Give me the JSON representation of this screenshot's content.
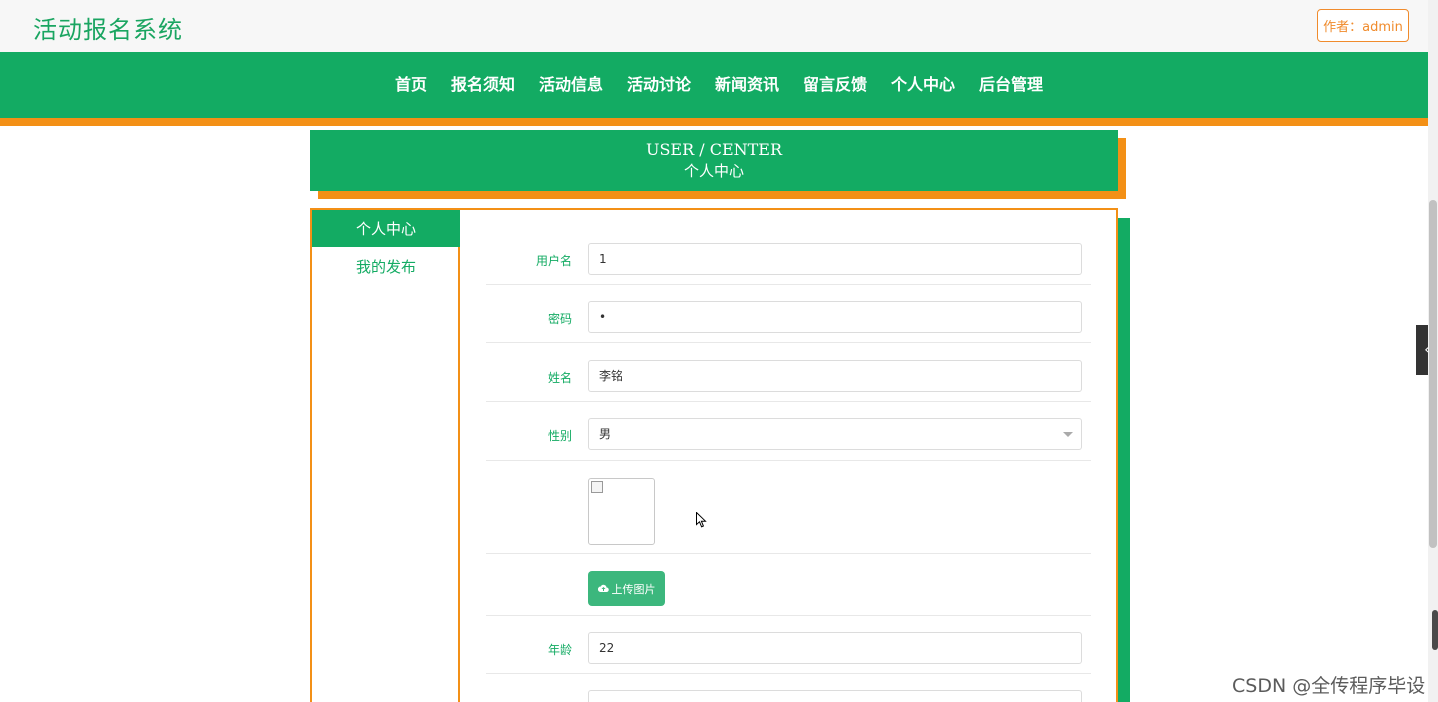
{
  "header": {
    "brand": "活动报名系统",
    "author_button": "作者：admin"
  },
  "nav": {
    "items": [
      "首页",
      "报名须知",
      "活动信息",
      "活动讨论",
      "新闻资讯",
      "留言反馈",
      "个人中心",
      "后台管理"
    ]
  },
  "banner": {
    "title_en": "USER / CENTER",
    "title_cn": "个人中心"
  },
  "sidebar": {
    "items": [
      "个人中心",
      "我的发布"
    ],
    "active_index": 0
  },
  "form": {
    "username": {
      "label": "用户名",
      "value": "1"
    },
    "password": {
      "label": "密码",
      "value": "•"
    },
    "name": {
      "label": "姓名",
      "value": "李铭"
    },
    "gender": {
      "label": "性别",
      "value": "男"
    },
    "upload_button": "上传图片",
    "age": {
      "label": "年龄",
      "value": "22"
    }
  },
  "watermark": "CSDN @全传程序毕设",
  "colors": {
    "primary_green": "#13ab63",
    "accent_orange": "#f39016"
  }
}
